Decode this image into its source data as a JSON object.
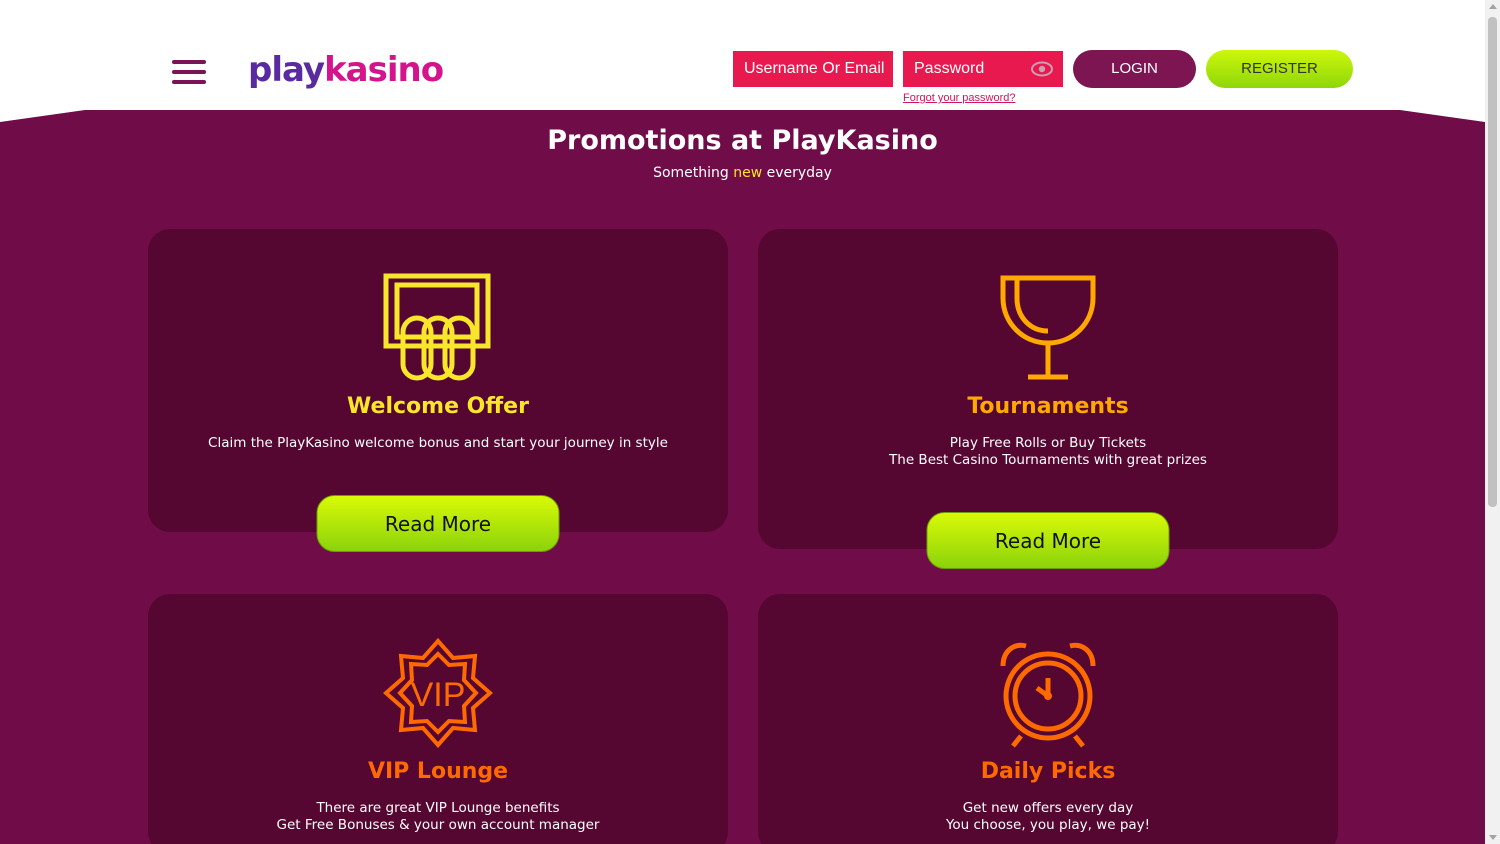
{
  "header": {
    "logo_part1": "play",
    "logo_part2": "kasino",
    "username_placeholder": "Username Or Email",
    "password_placeholder": "Password",
    "forgot_password": "Forgot your password?",
    "login_label": "LOGIN",
    "register_label": "REGISTER"
  },
  "page": {
    "title": "Promotions at PlayKasino",
    "subtitle_before": "Something ",
    "subtitle_highlight": "new",
    "subtitle_after": " everyday"
  },
  "cards": [
    {
      "icon": "coupon-icon",
      "title": "Welcome Offer",
      "title_color": "#f8e62a",
      "desc_line1": "Claim the PlayKasino welcome bonus and start your journey in style",
      "desc_line2": "",
      "button": "Read More"
    },
    {
      "icon": "trophy-icon",
      "title": "Tournaments",
      "title_color": "#ffa800",
      "desc_line1": "Play Free Rolls or Buy Tickets",
      "desc_line2": "The Best Casino Tournaments with great prizes",
      "button": "Read More"
    },
    {
      "icon": "vip-badge-icon",
      "title": "VIP Lounge",
      "title_color": "#ff6a00",
      "desc_line1": "There are great VIP Lounge benefits",
      "desc_line2": "Get Free Bonuses & your own account manager",
      "button": ""
    },
    {
      "icon": "alarm-clock-icon",
      "title": "Daily Picks",
      "title_color": "#ff6a00",
      "desc_line1": "Get new offers every day",
      "desc_line2": "You choose, you play, we pay!",
      "button": ""
    }
  ],
  "colors": {
    "background": "#700d48",
    "card": "#550731",
    "accent_pink": "#e8194e",
    "accent_lime": "#c7f50a"
  }
}
